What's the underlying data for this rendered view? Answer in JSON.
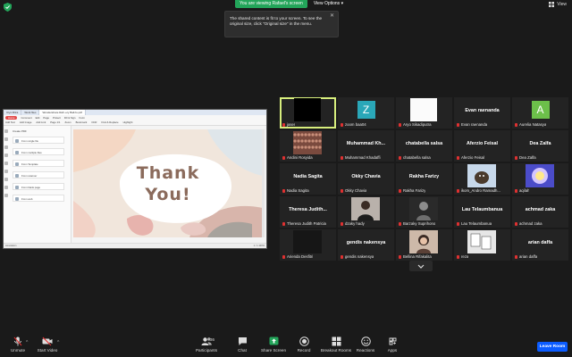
{
  "topbar": {
    "viewing_label": "You are viewing Rafael's screen",
    "view_options_label": "View Options ▾",
    "view_label": "View"
  },
  "tooltip": {
    "text": "The shared content is fit to your screen. To see the original size, click \"Original size\" in the menu."
  },
  "share": {
    "tabs": [
      "Ulys Mitra",
      "Work files",
      "Wondershare Rafi..ery Ball-fo.pdf"
    ],
    "ribbon_menu": [
      "Home",
      "Comment",
      "Edit",
      "Page",
      "Protect",
      "Fill & Sign",
      "Form"
    ],
    "ribbon_tools": [
      "Add Text",
      "Add Image",
      "Add Link",
      "Page 1/1",
      "Zoom",
      "Bookmark",
      "OCR",
      "Find & Replace",
      "Highlight"
    ],
    "panel_title": "Create PDF",
    "panel_items": [
      "From single file",
      "From multiple files",
      "From Template",
      "From scanner",
      "From blank page",
      "From web"
    ],
    "slide_line1": "Thank",
    "slide_line2": "You!",
    "status_left": "Annotation",
    "status_right": "1 / 1   100%"
  },
  "participants": [
    {
      "name": "",
      "label": "jaser",
      "avatar": "black"
    },
    {
      "name": "",
      "label": "zoom baa04",
      "avatar": "Z",
      "avatar_color": "#2aa7b8"
    },
    {
      "name": "",
      "label": "Aryo Sikadiputra",
      "avatar": "white"
    },
    {
      "name": "Evan raenanda",
      "label": "Evan raenanda"
    },
    {
      "name": "",
      "label": "Aurelia Natasya",
      "avatar": "A",
      "avatar_color": "#6cc04a"
    },
    {
      "name": "",
      "label": "Andini Rosyida",
      "avatar": "crowd"
    },
    {
      "name": "Muhammad Kh...",
      "label": "Muhammad Khadaffi"
    },
    {
      "name": "chatabella salsa",
      "label": "chatabella salsa"
    },
    {
      "name": "Aferzio Feisal",
      "label": "Aferzio Feisal"
    },
    {
      "name": "Dea Zalfa",
      "label": "Dea Zalfa"
    },
    {
      "name": "Nadia Sagita",
      "label": "Nadia Sagita"
    },
    {
      "name": "Okky Chavia",
      "label": "Okky Chavia"
    },
    {
      "name": "Rakha Farizy",
      "label": "Rakha Farizy"
    },
    {
      "name": "",
      "label": "ikom_Andro Ramadh...",
      "avatar": "dog"
    },
    {
      "name": "",
      "label": "aqilah",
      "avatar": "glow"
    },
    {
      "name": "Theresa Judith...",
      "label": "Theresa Judith Patricia"
    },
    {
      "name": "",
      "label": "dzaky hady",
      "avatar": "person"
    },
    {
      "name": "",
      "label": "Barzaky Suprihono",
      "avatar": "bw"
    },
    {
      "name": "Lau Telaumbanua",
      "label": "Lau Telaumbanua"
    },
    {
      "name": "achmad zaka",
      "label": "achmad zaka"
    },
    {
      "name": "",
      "label": "Arienda Desfitri",
      "avatar": "dark"
    },
    {
      "name": "gendis nakensya",
      "label": "gendis nakensya"
    },
    {
      "name": "",
      "label": "Bellina Rifakalita",
      "avatar": "girl"
    },
    {
      "name": "",
      "label": "reza",
      "avatar": "cards"
    },
    {
      "name": "arian daffa",
      "label": "arian daffa"
    }
  ],
  "toolbar": {
    "unmute": "Unmute",
    "start_video": "Start Video",
    "participants": "Participants",
    "participants_count": "36",
    "chat": "Chat",
    "share_screen": "Share Screen",
    "record": "Record",
    "breakout": "Breakout Rooms",
    "reactions": "Reactions",
    "apps": "Apps",
    "leave": "Leave Room"
  },
  "colors": {
    "share_green": "#23a55a",
    "leave_blue": "#0b5cff",
    "active_speaker": "#d7ee7d",
    "muted_red": "#e03131"
  }
}
